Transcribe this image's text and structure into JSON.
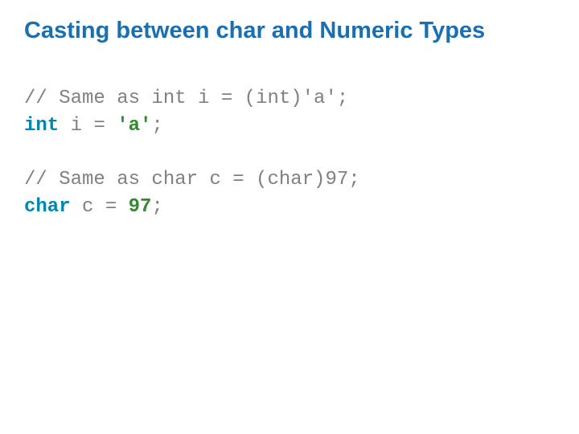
{
  "title": "Casting between char and Numeric Types",
  "code": {
    "comment1": "// Same as int i = (int)'a';",
    "kw_int": "int",
    "ident_i": "i",
    "eq": "=",
    "lit_a": "'a'",
    "semi1": ";",
    "comment2": "// Same as char c = (char)97;",
    "kw_char": "char",
    "ident_c": "c",
    "lit_97": "97",
    "semi2": ";"
  }
}
